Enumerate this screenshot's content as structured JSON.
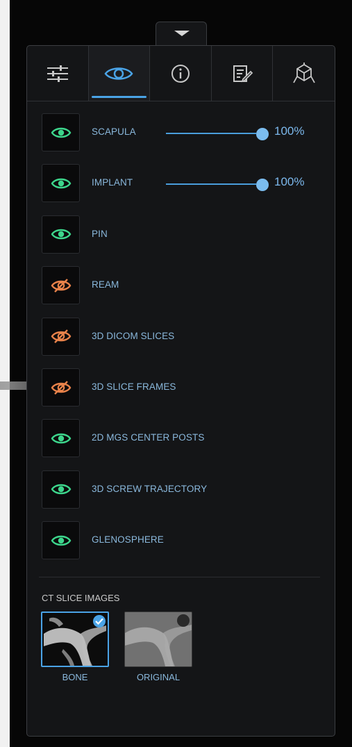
{
  "tabs": [
    {
      "name": "settings",
      "icon": "sliders-icon",
      "active": false
    },
    {
      "name": "visibility",
      "icon": "eye-icon",
      "active": true
    },
    {
      "name": "info",
      "icon": "info-icon",
      "active": false
    },
    {
      "name": "notes",
      "icon": "edit-note-icon",
      "active": false
    },
    {
      "name": "view3d",
      "icon": "cube-axes-icon",
      "active": false
    }
  ],
  "items": [
    {
      "label": "SCAPULA",
      "visible": true,
      "opacity": "100%",
      "opacity_value": 1.0
    },
    {
      "label": "IMPLANT",
      "visible": true,
      "opacity": "100%",
      "opacity_value": 1.0
    },
    {
      "label": "PIN",
      "visible": true
    },
    {
      "label": "REAM",
      "visible": false
    },
    {
      "label": "3D DICOM SLICES",
      "visible": false
    },
    {
      "label": "3D SLICE FRAMES",
      "visible": false
    },
    {
      "label": "2D MGS CENTER POSTS",
      "visible": true
    },
    {
      "label": "3D SCREW TRAJECTORY",
      "visible": true
    },
    {
      "label": "GLENOSPHERE",
      "visible": true
    }
  ],
  "ct_slice": {
    "title": "CT SLICE IMAGES",
    "options": [
      {
        "label": "BONE",
        "selected": true
      },
      {
        "label": "ORIGINAL",
        "selected": false
      }
    ]
  },
  "colors": {
    "visible": "#3dd68c",
    "hidden": "#e8824a",
    "accent": "#4aa3e6"
  }
}
